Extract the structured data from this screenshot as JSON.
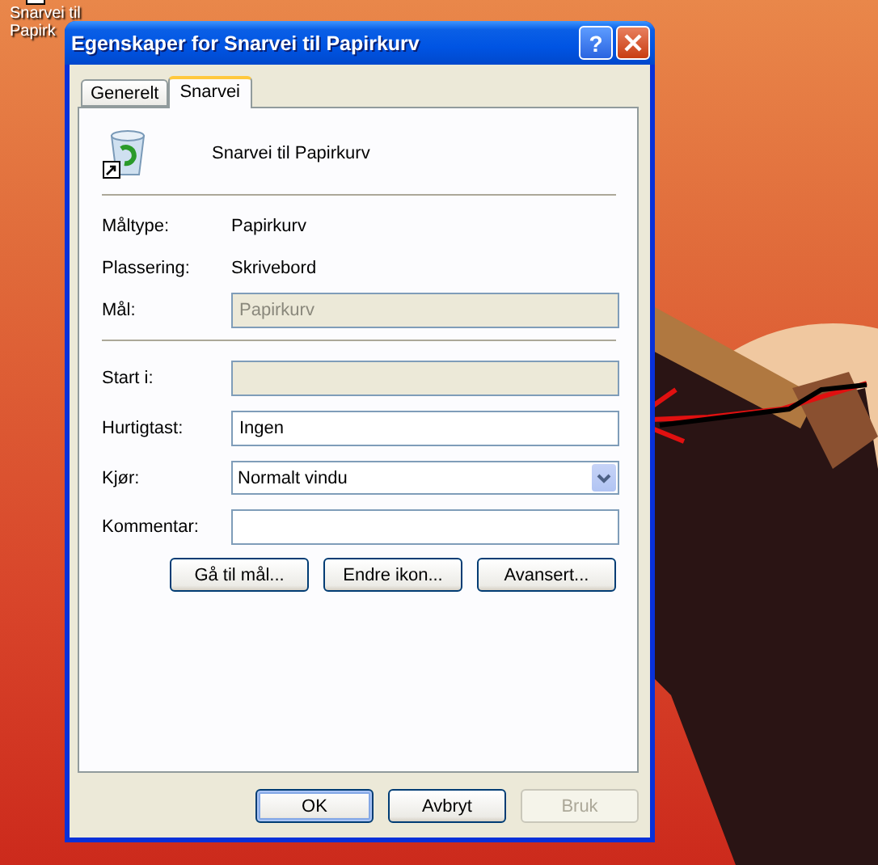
{
  "desktop_icon": {
    "label_lines": [
      "Snarvei til",
      "Papirk"
    ]
  },
  "window": {
    "title": "Egenskaper for Snarvei til Papirkurv",
    "help_button": "?"
  },
  "tabs": [
    {
      "label": "Generelt",
      "selected": false
    },
    {
      "label": "Snarvei",
      "selected": true
    }
  ],
  "shortcut_name": "Snarvei til Papirkurv",
  "info_rows": [
    {
      "label": "Måltype:",
      "value": "Papirkurv"
    },
    {
      "label": "Plassering:",
      "value": "Skrivebord"
    }
  ],
  "target": {
    "label": "Mål:",
    "value": "Papirkurv",
    "disabled": true
  },
  "fields": [
    {
      "kind": "text",
      "label": "Start i:",
      "disabled": true
    },
    {
      "kind": "text",
      "label": "Hurtigtast:",
      "value": "Ingen",
      "disabled": false
    },
    {
      "kind": "select",
      "label": "Kjør:",
      "value": "Normalt vindu",
      "disabled": false
    },
    {
      "kind": "text",
      "label": "Kommentar:",
      "disabled": false
    }
  ],
  "actions": [
    "Gå til mål...",
    "Endre ikon...",
    "Avansert..."
  ],
  "buttons": [
    {
      "label": "OK",
      "default": true,
      "disabled": false
    },
    {
      "label": "Avbryt",
      "default": false,
      "disabled": false
    },
    {
      "label": "Bruk",
      "default": false,
      "disabled": true
    }
  ]
}
